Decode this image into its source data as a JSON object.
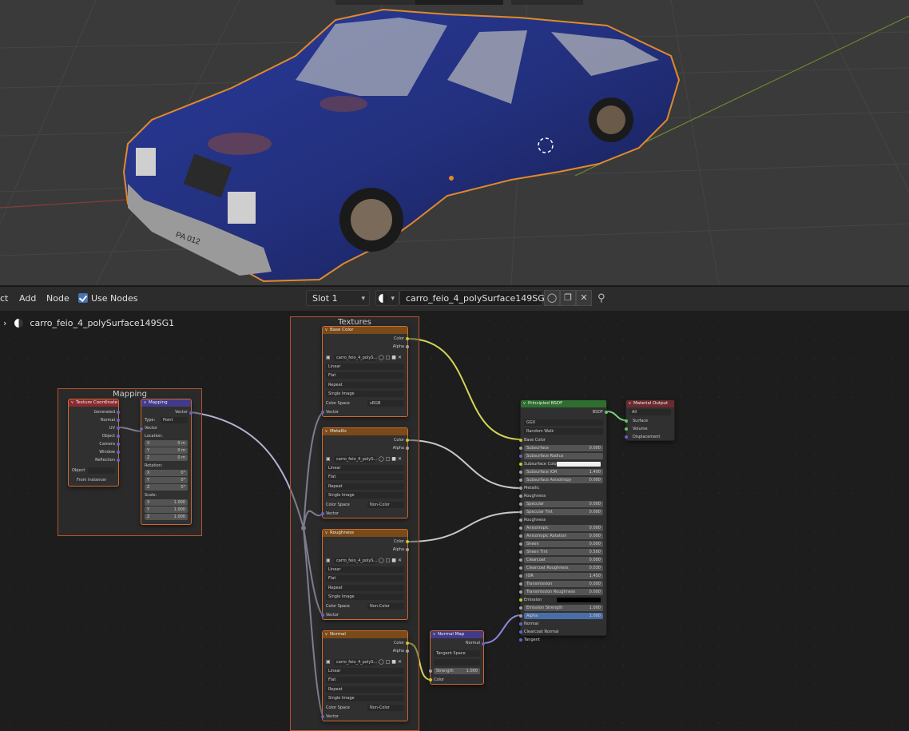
{
  "viewport": {
    "license_plate": "PA 012"
  },
  "header": {
    "menu_edge": "ct",
    "menu_add": "Add",
    "menu_node": "Node",
    "use_nodes_label": "Use Nodes",
    "slot": "Slot 1",
    "material_name": "carro_feio_4_polySurface149SG1"
  },
  "breadcrumb": {
    "material": "carro_feio_4_polySurface149SG1"
  },
  "frames": {
    "mapping": "Mapping",
    "textures": "Textures"
  },
  "texcoord": {
    "title": "Texture Coordinate",
    "outputs": [
      "Generated",
      "Normal",
      "UV",
      "Object",
      "Camera",
      "Window",
      "Reflection"
    ],
    "object_label": "Object",
    "from_instancer": "From Instancer"
  },
  "mapping": {
    "title": "Mapping",
    "output": "Vector",
    "type_label": "Type:",
    "type_value": "Point",
    "input_vector": "Vector",
    "location_label": "Location:",
    "location": [
      {
        "axis": "X",
        "val": "0 m"
      },
      {
        "axis": "Y",
        "val": "0 m"
      },
      {
        "axis": "Z",
        "val": "0 m"
      }
    ],
    "rotation_label": "Rotation:",
    "rotation": [
      {
        "axis": "X",
        "val": "0°"
      },
      {
        "axis": "Y",
        "val": "0°"
      },
      {
        "axis": "Z",
        "val": "0°"
      }
    ],
    "scale_label": "Scale:",
    "scale": [
      {
        "axis": "X",
        "val": "1.000"
      },
      {
        "axis": "Y",
        "val": "1.000"
      },
      {
        "axis": "Z",
        "val": "1.000"
      }
    ]
  },
  "image_nodes": [
    {
      "title": "Base Color",
      "image": "carro_feio_4_polyS...",
      "interp": "Linear",
      "proj": "Flat",
      "ext": "Repeat",
      "source": "Single Image",
      "cs_label": "Color Space",
      "cs": "sRGB",
      "out_color": "Color",
      "out_alpha": "Alpha",
      "in_vector": "Vector"
    },
    {
      "title": "Metallic",
      "image": "carro_feio_4_polyS...",
      "interp": "Linear",
      "proj": "Flat",
      "ext": "Repeat",
      "source": "Single Image",
      "cs_label": "Color Space",
      "cs": "Non-Color",
      "out_color": "Color",
      "out_alpha": "Alpha",
      "in_vector": "Vector"
    },
    {
      "title": "Roughness",
      "image": "carro_feio_4_polyS...",
      "interp": "Linear",
      "proj": "Flat",
      "ext": "Repeat",
      "source": "Single Image",
      "cs_label": "Color Space",
      "cs": "Non-Color",
      "out_color": "Color",
      "out_alpha": "Alpha",
      "in_vector": "Vector"
    },
    {
      "title": "Normal",
      "image": "carro_feio_4_polyS...",
      "interp": "Linear",
      "proj": "Flat",
      "ext": "Repeat",
      "source": "Single Image",
      "cs_label": "Color Space",
      "cs": "Non-Color",
      "out_color": "Color",
      "out_alpha": "Alpha",
      "in_vector": "Vector"
    }
  ],
  "normal_map": {
    "title": "Normal Map",
    "output": "Normal",
    "space": "Tangent Space",
    "uv": "",
    "strength_label": "Strength",
    "strength": "1.000",
    "input_color": "Color"
  },
  "bsdf": {
    "title": "Principled BSDF",
    "output": "BSDF",
    "distribution": "GGX",
    "subsurface_method": "Random Walk",
    "base_color": "Base Color",
    "rows": [
      {
        "label": "Subsurface",
        "val": "0.000"
      },
      {
        "label": "Subsurface Radius",
        "val": ""
      },
      {
        "label": "Subsurface Colo",
        "val": ""
      },
      {
        "label": "Subsurface IOR",
        "val": "1.400"
      },
      {
        "label": "Subsurface Anisotropy",
        "val": "0.000"
      },
      {
        "label": "Metallic",
        "val": ""
      },
      {
        "label": "Roughness",
        "val": ""
      },
      {
        "label": "Specular",
        "val": "0.000"
      },
      {
        "label": "Specular Tint",
        "val": "0.000"
      },
      {
        "label": "Roughness",
        "val": ""
      },
      {
        "label": "Anisotropic",
        "val": "0.000"
      },
      {
        "label": "Anisotropic Rotation",
        "val": "0.000"
      },
      {
        "label": "Sheen",
        "val": "0.000"
      },
      {
        "label": "Sheen Tint",
        "val": "0.500"
      },
      {
        "label": "Clearcoat",
        "val": "0.000"
      },
      {
        "label": "Clearcoat Roughness",
        "val": "0.030"
      },
      {
        "label": "IOR",
        "val": "1.450"
      },
      {
        "label": "Transmission",
        "val": "0.000"
      },
      {
        "label": "Transmission Roughness",
        "val": "0.000"
      },
      {
        "label": "Emission",
        "val": ""
      },
      {
        "label": "Emission Strength",
        "val": "1.000"
      },
      {
        "label": "Alpha",
        "val": "1.000"
      },
      {
        "label": "Normal",
        "val": ""
      },
      {
        "label": "Clearcoat Normal",
        "val": ""
      },
      {
        "label": "Tangent",
        "val": ""
      }
    ]
  },
  "material_output": {
    "title": "Material Output",
    "target": "All",
    "inputs": [
      "Surface",
      "Volume",
      "Displacement"
    ]
  },
  "colors": {
    "accent": "#4772b3",
    "frame": "#b3532a",
    "selected": "#d06a30",
    "color_socket": "#c7c729",
    "float_socket": "#a1a1a1",
    "vector_socket": "#6363c7",
    "shader_socket": "#63c763"
  }
}
